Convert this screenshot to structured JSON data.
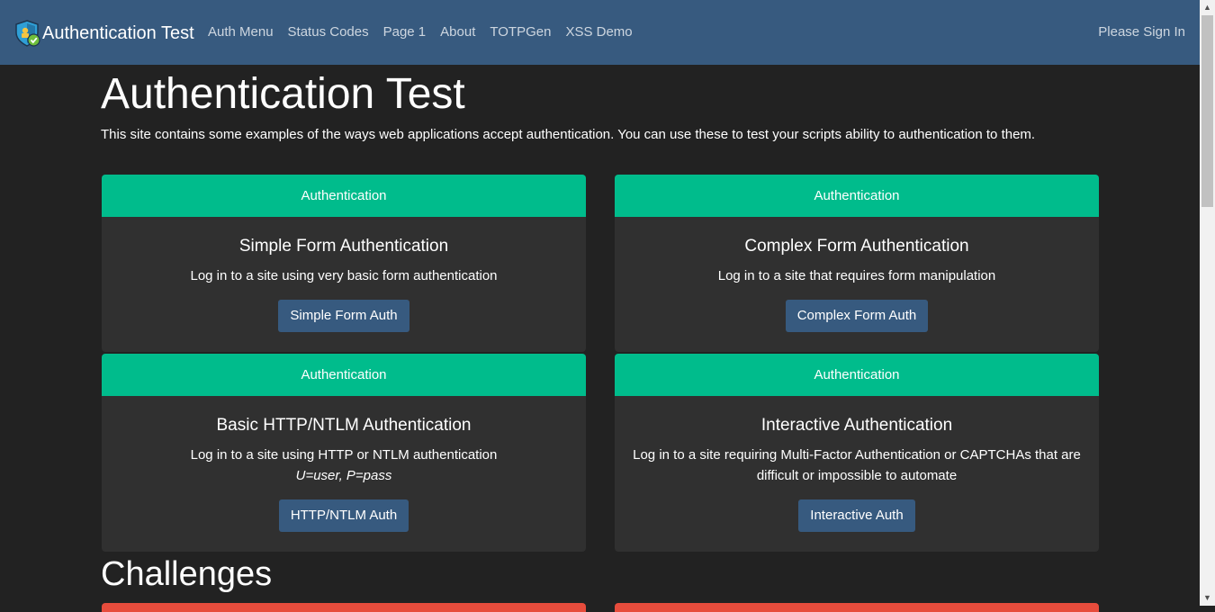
{
  "navbar": {
    "brand": "Authentication Test",
    "links": [
      "Auth Menu",
      "Status Codes",
      "Page 1",
      "About",
      "TOTPGen",
      "XSS Demo"
    ],
    "signin": "Please Sign In"
  },
  "main": {
    "title": "Authentication Test",
    "lead": "This site contains some examples of the ways web applications accept authentication. You can use these to test your scripts ability to authentication to them.",
    "cards": [
      {
        "header": "Authentication",
        "title": "Simple Form Authentication",
        "text": "Log in to a site using very basic form authentication",
        "button": "Simple Form Auth"
      },
      {
        "header": "Authentication",
        "title": "Complex Form Authentication",
        "text": "Log in to a site that requires form manipulation",
        "button": "Complex Form Auth"
      },
      {
        "header": "Authentication",
        "title": "Basic HTTP/NTLM Authentication",
        "text": "Log in to a site using HTTP or NTLM authentication",
        "creds": "U=user, P=pass",
        "button": "HTTP/NTLM Auth"
      },
      {
        "header": "Authentication",
        "title": "Interactive Authentication",
        "text": "Log in to a site requiring Multi-Factor Authentication or CAPTCHAs that are difficult or impossible to automate",
        "button": "Interactive Auth"
      }
    ],
    "challenges_heading": "Challenges"
  },
  "colors": {
    "navbar": "#375a7f",
    "background": "#222222",
    "card": "#303030",
    "card_header": "#00bc8c",
    "button": "#375a7f",
    "challenge_card": "#e74c3c"
  },
  "icons": {
    "brand": "shield-check-icon"
  }
}
